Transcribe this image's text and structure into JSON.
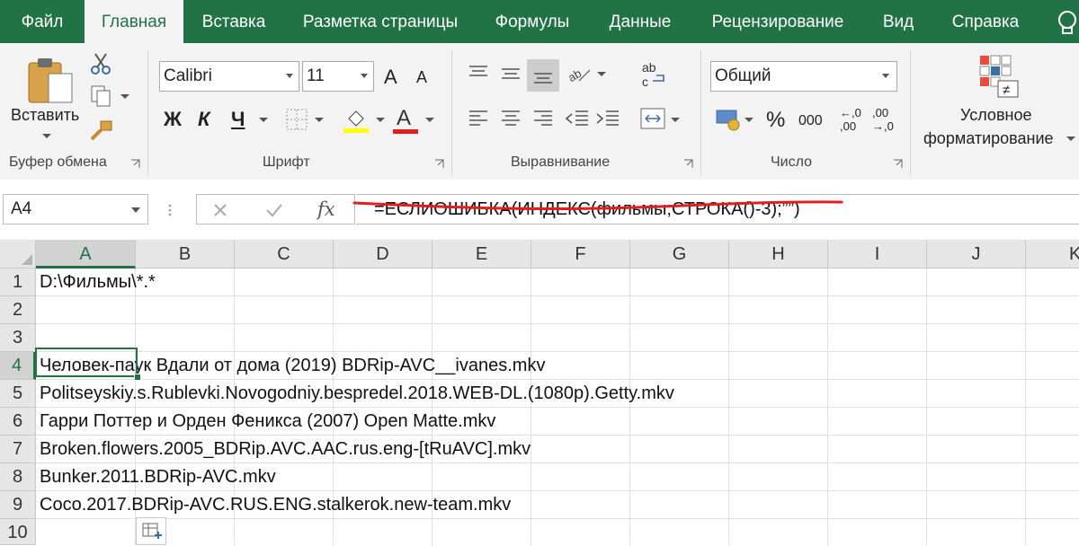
{
  "menu": {
    "tabs": [
      "Файл",
      "Главная",
      "Вставка",
      "Разметка страницы",
      "Формулы",
      "Данные",
      "Рецензирование",
      "Вид",
      "Справка"
    ],
    "active_index": 1
  },
  "ribbon": {
    "clipboard": {
      "paste_label": "Вставить",
      "group_label": "Буфер обмена"
    },
    "font": {
      "font_name": "Calibri",
      "font_size": "11",
      "bold": "Ж",
      "italic": "К",
      "underline": "Ч",
      "grow": "A",
      "shrink": "A",
      "font_color_letter": "A",
      "group_label": "Шрифт"
    },
    "alignment": {
      "group_label": "Выравнивание",
      "wrap_glyph": "ab"
    },
    "number": {
      "format": "Общий",
      "percent": "%",
      "thousands": "000",
      "inc_decimal": "←,0\n,00",
      "group_label": "Число",
      "inc_top": "←,0",
      "inc_bottom": ",00",
      "dec_top": ",00",
      "dec_bottom": "→,0"
    },
    "styles": {
      "cond_format_line1": "Условное",
      "cond_format_line2": "форматирование"
    }
  },
  "formula_bar": {
    "name_box": "A4",
    "fx": "fx",
    "formula": "=ЕСЛИОШИБКА(ИНДЕКС(фильмы;СТРОКА()-3);””)"
  },
  "sheet": {
    "columns": [
      "A",
      "B",
      "C",
      "D",
      "E",
      "F",
      "G",
      "H",
      "I",
      "J",
      "K"
    ],
    "selected_column": "A",
    "rows": [
      "1",
      "2",
      "3",
      "4",
      "5",
      "6",
      "7",
      "8",
      "9",
      "10"
    ],
    "selected_row": "4",
    "cells": {
      "A1": "D:\\Фильмы\\*.*",
      "A4": "Человек-паук Вдали от дома (2019) BDRip-AVC__ivanes.mkv",
      "A5": "Politseyskiy.s.Rublevki.Novogodniy.bespredel.2018.WEB-DL.(1080p).Getty.mkv",
      "A6": "Гарри Поттер и Орден Феникса (2007) Open Matte.mkv",
      "A7": "Broken.flowers.2005_BDRip.AVC.AAC.rus.eng-[tRuAVC].mkv",
      "A8": "Bunker.2011.BDRip-AVC.mkv",
      "A9": "Coco.2017.BDRip-AVC.RUS.ENG.stalkerok.new-team.mkv"
    }
  },
  "colors": {
    "accent": "#217346",
    "annotation": "#e02020",
    "fill_yellow": "#ffff00",
    "font_red": "#e02020"
  }
}
